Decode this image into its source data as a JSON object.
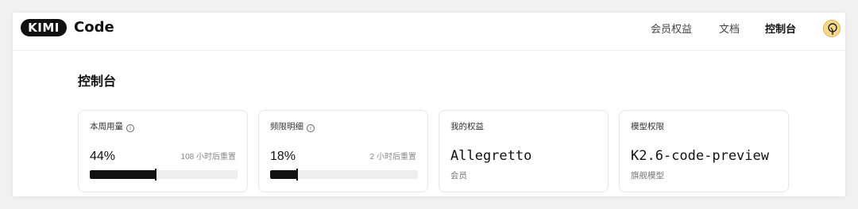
{
  "header": {
    "logo_pill": "KIMI",
    "logo_text": "Code",
    "nav": [
      "会员权益",
      "文档",
      "控制台"
    ],
    "active_nav": "控制台"
  },
  "page": {
    "title": "控制台"
  },
  "cards": {
    "weekly_usage": {
      "label": "本周用量",
      "percent": "44%",
      "fill": 0.44,
      "reset": "108 小时后重置"
    },
    "rate_limit": {
      "label": "频限明细",
      "percent": "18%",
      "fill": 0.18,
      "reset": "2 小时后重置"
    },
    "benefits": {
      "label": "我的权益",
      "value": "Allegretto",
      "sub": "会员"
    },
    "model": {
      "label": "模型权限",
      "value": "K2.6-code-preview",
      "sub": "旗舰模型"
    }
  },
  "icons": {
    "info": "info-icon",
    "avatar": "avatar-icon"
  },
  "colors": {
    "accent": "#111111",
    "track": "#eeeeee",
    "avatar": "#f7d88a"
  }
}
